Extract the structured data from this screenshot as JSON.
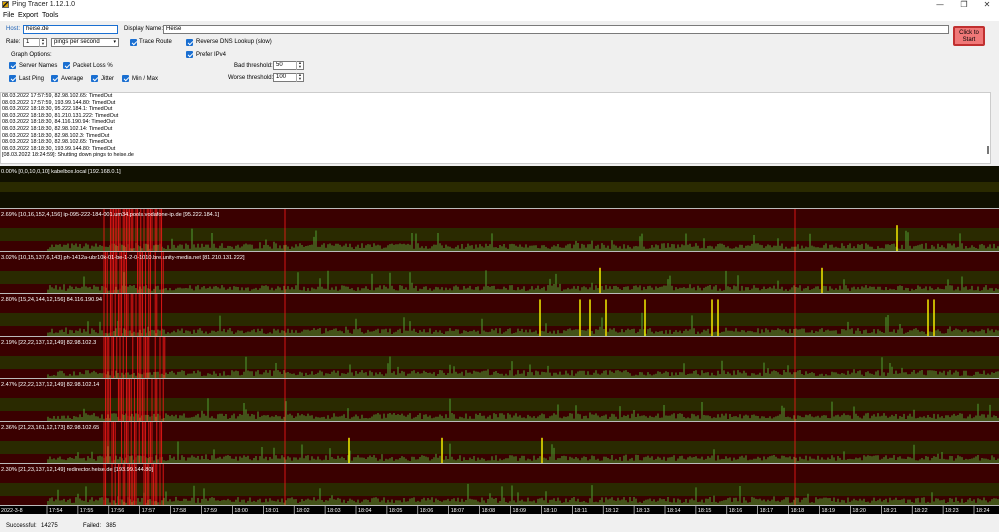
{
  "window": {
    "title": "Ping Tracer 1.12.1.0",
    "minimize_glyph": "—",
    "maximize_glyph": "❐",
    "close_glyph": "✕"
  },
  "menu": [
    "File",
    "Export",
    "Tools"
  ],
  "controls": {
    "host_label": "Host:",
    "host_value": "heise.de",
    "display_name_label": "Display Name:",
    "display_name_value": "Heise",
    "rate_label": "Rate:",
    "rate_value": "1",
    "rate_unit": "pings per second",
    "trace_route": "Trace Route",
    "reverse_dns": "Reverse DNS Lookup (slow)",
    "prefer_ipv4": "Prefer IPv4",
    "graph_options": "Graph Options:",
    "server_names": "Server Names",
    "packet_loss": "Packet Loss %",
    "last_ping": "Last Ping",
    "average": "Average",
    "jitter": "Jitter",
    "min_max": "Min / Max",
    "bad_threshold_label": "Bad threshold:",
    "bad_threshold_value": "50",
    "worse_threshold_label": "Worse threshold:",
    "worse_threshold_value": "100",
    "start_button": [
      "Click to",
      "Start"
    ]
  },
  "log": [
    "08.03.2022 17:57:59, 82.98.102.65: TimedOut",
    "08.03.2022 17:57:59, 193.99.144.80: TimedOut",
    "08.03.2022 18:18:30, 95.222.184.1: TimedOut",
    "08.03.2022 18:18:30, 81.210.131.222: TimedOut",
    "08.03.2022 18:18:30, 84.116.190.94: TimedOut",
    "08.03.2022 18:18:30, 82.98.102.14: TimedOut",
    "08.03.2022 18:18:30, 82.98.102.3: TimedOut",
    "08.03.2022 18:18:30, 82.98.102.65: TimedOut",
    "08.03.2022 18:18:30, 193.99.144.80: TimedOut",
    "[08.03.2022 18:24:59]: Shutting down pings to heise.de"
  ],
  "graphs": [
    {
      "label": "0.00% [0,0,10,0,10] kabelbox.local [192.168.0.1]",
      "loss_pct": 0.0,
      "variant": "flat"
    },
    {
      "label": "2.69% [10,16,152,4,156] ip-095-222-184-001.um34.pools.vodafone-ip.de [95.222.184.1]",
      "loss_pct": 2.69,
      "variant": "a"
    },
    {
      "label": "3.02% [10,15,137,6,143] ph-1412a-ubr10k-01-be-1-2-0-1010.bre.unity-media.net [81.210.131.222]",
      "loss_pct": 3.02,
      "variant": "b"
    },
    {
      "label": "2.80% [15,24,144,12,156] 84.116.190.94",
      "loss_pct": 2.8,
      "variant": "c"
    },
    {
      "label": "2.19% [22,22,137,12,149] 82.98.102.3",
      "loss_pct": 2.19,
      "variant": "d"
    },
    {
      "label": "2.47% [22,22,137,12,149] 82.98.102.14",
      "loss_pct": 2.47,
      "variant": "d"
    },
    {
      "label": "2.36% [21,23,161,12,173] 82.98.102.65",
      "loss_pct": 2.36,
      "variant": "e"
    },
    {
      "label": "2.30% [21,23,137,12,149] redirector.heise.de [193.99.144.80]",
      "loss_pct": 2.3,
      "variant": "d"
    }
  ],
  "time_axis": {
    "date": "2022-3-8",
    "ticks": [
      "17:54",
      "17:55",
      "17:56",
      "17:57",
      "17:58",
      "17:59",
      "18:00",
      "18:01",
      "18:02",
      "18:03",
      "18:04",
      "18:05",
      "18:06",
      "18:07",
      "18:08",
      "18:09",
      "18:10",
      "18:11",
      "18:12",
      "18:13",
      "18:14",
      "18:15",
      "18:16",
      "18:17",
      "18:18",
      "18:19",
      "18:20",
      "18:21",
      "18:22",
      "18:23",
      "18:24"
    ]
  },
  "status": {
    "successful_label": "Successful:",
    "successful_value": "14275",
    "failed_label": "Failed:",
    "failed_value": "385"
  },
  "colors": {
    "ok": "#4a8a2a",
    "bad": "#e8e000",
    "loss": "#ff1a1a",
    "band_dark": "#101000",
    "band_red": "#3a0000",
    "band_olive": "#2a2a00"
  }
}
